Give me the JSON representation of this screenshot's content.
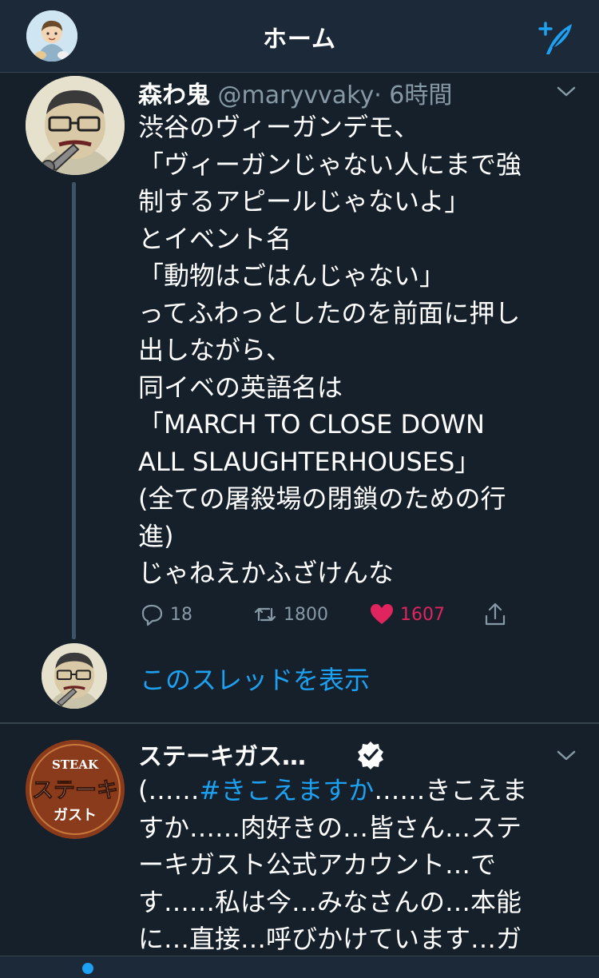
{
  "header": {
    "title": "ホーム"
  },
  "tweets": [
    {
      "name": "森わ鬼",
      "handle": "@maryvvaky",
      "time": "· 6時間",
      "lines": [
        "渋谷のヴィーガンデモ、",
        "「ヴィーガンじゃない人にまで強",
        "制するアピールじゃないよ」",
        "とイベント名",
        "「動物はごはんじゃない」",
        "ってふわっとしたのを前面に押し",
        "出しながら、",
        "同イベの英語名は",
        "「MARCH TO CLOSE DOWN",
        "ALL SLAUGHTERHOUSES」",
        "(全ての屠殺場の閉鎖のための行",
        "進)",
        "じゃねえかふざけんな"
      ],
      "replies": "18",
      "retweets": "1800",
      "likes": "1607",
      "show_thread": "このスレッドを表示"
    },
    {
      "name": "ステーキガス…",
      "logo_text": {
        "top": "STEAK",
        "middle": "ステーキ",
        "bottom": "ガスト"
      },
      "line1_prefix": "(……",
      "hashtag": "#きこえますか",
      "line1_suffix": "……きこえま",
      "lines": [
        "すか……肉好きの…皆さん…ステ",
        "ーキガスト公式アカウント…で",
        "す……私は今…みなさんの…本能",
        "に…直接…呼びかけています…ガ"
      ]
    }
  ],
  "colors": {
    "background": "#15202b",
    "accent": "#1da1f2",
    "like": "#e0245e",
    "muted": "#8899a6"
  }
}
